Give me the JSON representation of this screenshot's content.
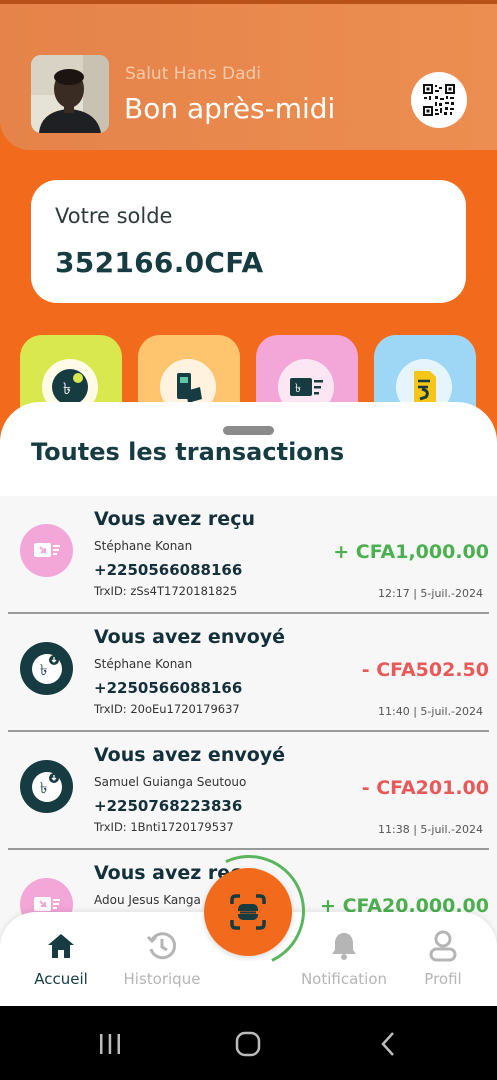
{
  "header": {
    "greeting": "Salut Hans Dadi",
    "time_of_day": "Bon après-midi",
    "qr_icon": "qr-code-icon"
  },
  "balance": {
    "label": "Votre solde",
    "value": "352166.0CFA"
  },
  "quick_actions": [
    {
      "icon": "send-money-icon",
      "color": "#D9E84E"
    },
    {
      "icon": "atm-withdraw-icon",
      "color": "#FFC56E"
    },
    {
      "icon": "receive-money-icon",
      "color": "#F3A6D8"
    },
    {
      "icon": "bill-payment-icon",
      "color": "#9DD7F5"
    }
  ],
  "transactions_title": "Toutes les transactions",
  "transactions": [
    {
      "title": "Vous avez reçu",
      "name": "Stéphane Konan",
      "phone": "+2250566088166",
      "trx": "TrxID: zSs4T1720181825",
      "amount": "+ CFA1,000.00",
      "direction": "in",
      "date": "12:17 | 5-juil.-2024"
    },
    {
      "title": "Vous avez envoyé",
      "name": "Stéphane Konan",
      "phone": "+2250566088166",
      "trx": "TrxID: 20oEu1720179637",
      "amount": "- CFA502.50",
      "direction": "out",
      "date": "11:40 | 5-juil.-2024"
    },
    {
      "title": "Vous avez envoyé",
      "name": "Samuel Guianga Seutouo",
      "phone": "+2250768223836",
      "trx": "TrxID: 1Bnti1720179537",
      "amount": "- CFA201.00",
      "direction": "out",
      "date": "11:38 | 5-juil.-2024"
    },
    {
      "title": "Vous avez reçu",
      "name": "Adou Jesus Kanga",
      "phone": "",
      "trx": "",
      "amount": "+ CFA20,000.00",
      "direction": "in",
      "date": ""
    }
  ],
  "nav": {
    "home": "Accueil",
    "history": "Historique",
    "notification": "Notification",
    "profile": "Profil"
  },
  "colors": {
    "accent": "#F26A1B",
    "positive": "#4CAF50",
    "negative": "#E85A5A",
    "dark_text": "#163C42"
  }
}
